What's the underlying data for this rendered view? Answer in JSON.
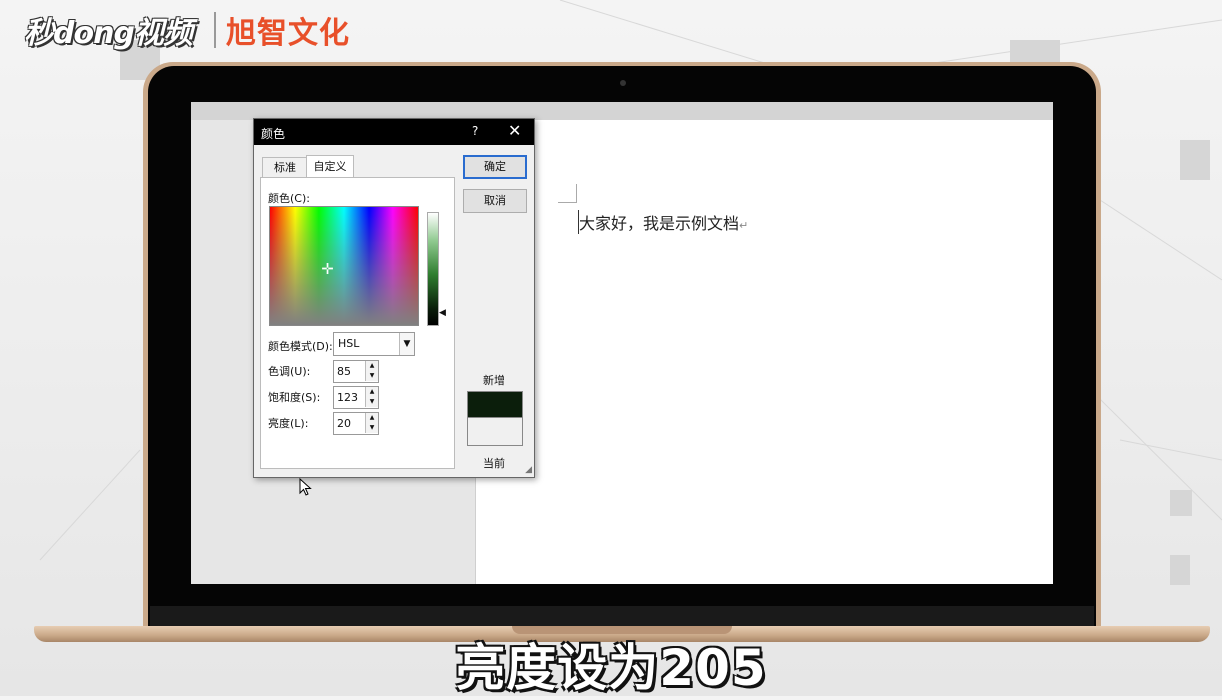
{
  "watermark": {
    "brand_left": "秒dong视频",
    "brand_right": "旭智文化"
  },
  "document": {
    "text": "大家好，我是示例文档",
    "para_mark": "↵"
  },
  "dialog": {
    "title": "颜色",
    "help": "?",
    "close": "✕",
    "tabs": {
      "standard": "标准",
      "custom": "自定义"
    },
    "colors_label": "颜色(C):",
    "mode_label": "颜色模式(D):",
    "mode_value": "HSL",
    "hue_label": "色调(U):",
    "hue_value": "85",
    "saturation_label": "饱和度(S):",
    "saturation_value": "123",
    "luminance_label": "亮度(L):",
    "luminance_value": "20",
    "ok": "确定",
    "cancel": "取消",
    "new_label": "新增",
    "current_label": "当前",
    "new_color": "#0b1e0b",
    "current_color": "#f0f0f0"
  },
  "subtitle": "亮度设为205",
  "colors": {
    "accent": "#2a6ccf",
    "logo_right": "#e8502a",
    "laptop": "#caa98a"
  }
}
